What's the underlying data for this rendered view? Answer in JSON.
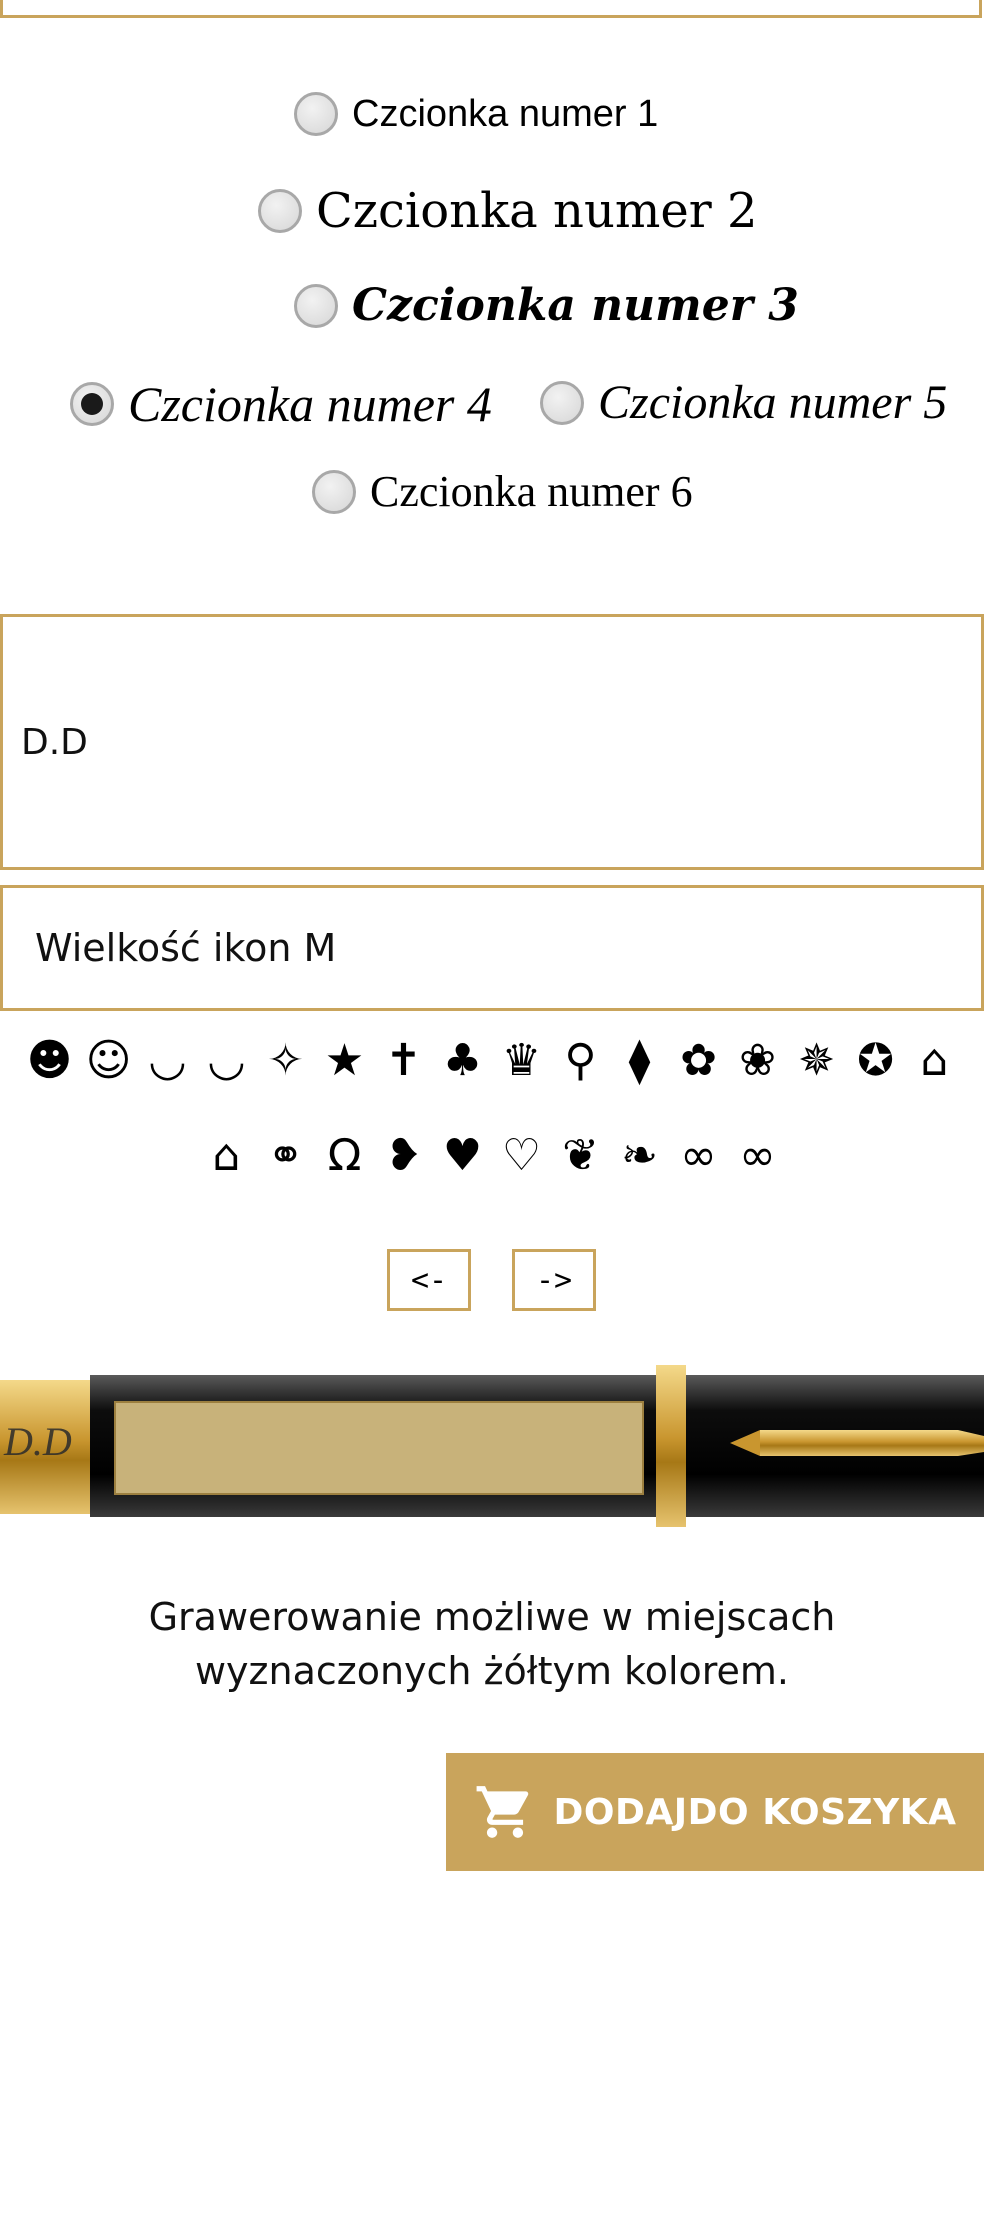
{
  "font_options": [
    {
      "label": "Czcionka numer 1",
      "checked": false
    },
    {
      "label": "Czcionka numer 2",
      "checked": false
    },
    {
      "label": "Czcionka numer 3",
      "checked": false
    },
    {
      "label": "Czcionka numer 4",
      "checked": true
    },
    {
      "label": "Czcionka numer 5",
      "checked": false
    },
    {
      "label": "Czcionka numer 6",
      "checked": false
    }
  ],
  "engraving_text": "D.D",
  "icon_size": "Wielkość ikon M",
  "icons_row1": [
    "smiley-icon",
    "smile-outline-icon",
    "grin-icon",
    "laugh-icon",
    "shooting-star-icon",
    "star-icon",
    "ihs-icon",
    "clover-icon",
    "crown-icon",
    "cat-icon",
    "tie-icon",
    "rose-icon",
    "rose-bud-icon",
    "paw-icon",
    "medal-icon",
    "grad-cap-icon"
  ],
  "icons_row2": [
    "grad-cap-small-icon",
    "rings-icon",
    "horseshoe-icon",
    "heart-half-icon",
    "heart-icon",
    "heart-outline-icon",
    "heart-script-icon",
    "hearts-link-icon",
    "infinity-small-icon",
    "infinity-icon"
  ],
  "icon_glyphs_row1": [
    "☻",
    "☺",
    "◡",
    "◡",
    "✧",
    "★",
    "✝",
    "♣",
    "♛",
    "⚲",
    "⧫",
    "✿",
    "❀",
    "✵",
    "✪",
    "⌂"
  ],
  "icon_glyphs_row2": [
    "⌂",
    "⚭",
    "Ω",
    "❥",
    "♥",
    "♡",
    "❦",
    "❧",
    "∞",
    "∞"
  ],
  "nav": {
    "prev": "<-",
    "next": "->"
  },
  "pen_engraving": "D.D",
  "info_line1": "Grawerowanie możliwe w miejscach",
  "info_line2": "wyznaczonych żółtym kolorem.",
  "cart_button": "DODAJDO KOSZYKA",
  "colors": {
    "accent": "#c9a45c",
    "engrave_area": "#c8b27a"
  }
}
